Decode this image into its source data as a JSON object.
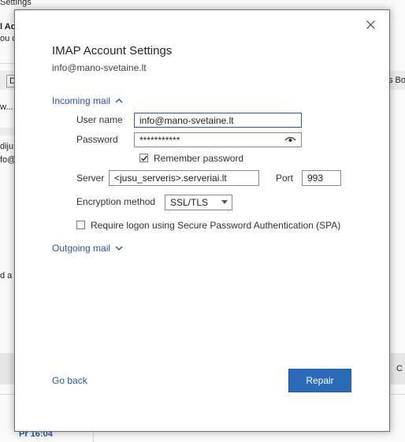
{
  "background": {
    "frag_settings": "Settings",
    "frag_ac": "l Ac",
    "frag_ou": "ou c",
    "frag_tab_d": "D",
    "frag_tab_right": "s Bo",
    "frag_w": "w...",
    "frag_diju": "diju",
    "frag_fo": "fo@",
    "frag_da": "d a",
    "frag_c": "C",
    "frag_time": "Pr 16:04",
    "frag_dash": "--"
  },
  "dialog": {
    "title": "IMAP Account Settings",
    "account_email": "info@mano-svetaine.lt",
    "close_icon": "close-icon"
  },
  "incoming": {
    "toggle_label": "Incoming mail",
    "username_label": "User name",
    "username_value": "info@mano-svetaine.lt",
    "password_label": "Password",
    "password_value": "***********",
    "remember_label": "Remember password",
    "remember_checked": true,
    "server_label": "Server",
    "server_value": "<jusu_serveris>.serveriai.lt",
    "port_label": "Port",
    "port_value": "993",
    "encryption_label": "Encryption method",
    "encryption_value": "SSL/TLS",
    "spa_label": "Require logon using Secure Password Authentication (SPA)",
    "spa_checked": false
  },
  "outgoing": {
    "toggle_label": "Outgoing mail"
  },
  "footer": {
    "back_label": "Go back",
    "repair_label": "Repair"
  },
  "colors": {
    "accent": "#2b579a",
    "button": "#2b6ab8"
  }
}
